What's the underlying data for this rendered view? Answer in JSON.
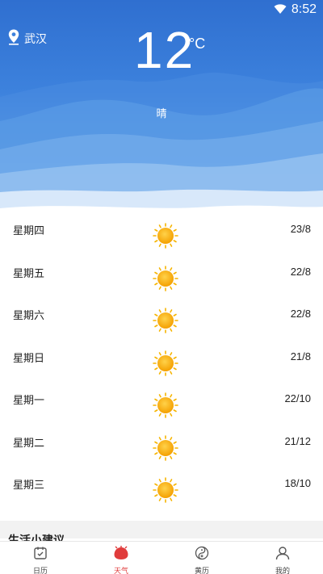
{
  "status": {
    "time": "8:52"
  },
  "location": {
    "city": "武汉"
  },
  "current": {
    "temperature": "12",
    "unit": "°C",
    "condition": "晴"
  },
  "forecast": [
    {
      "day": "星期四",
      "range": "23/8",
      "icon": "sun-icon"
    },
    {
      "day": "星期五",
      "range": "22/8",
      "icon": "sun-icon"
    },
    {
      "day": "星期六",
      "range": "22/8",
      "icon": "sun-icon"
    },
    {
      "day": "星期日",
      "range": "21/8",
      "icon": "sun-icon"
    },
    {
      "day": "星期一",
      "range": "22/10",
      "icon": "sun-icon"
    },
    {
      "day": "星期二",
      "range": "21/12",
      "icon": "sun-icon"
    },
    {
      "day": "星期三",
      "range": "18/10",
      "icon": "sun-icon"
    }
  ],
  "tips": {
    "title": "生活小建议"
  },
  "tabs": [
    {
      "label": "日历",
      "icon": "calendar-icon"
    },
    {
      "label": "天气",
      "icon": "weather-icon",
      "active": true
    },
    {
      "label": "黄历",
      "icon": "yin-yang-icon"
    },
    {
      "label": "我的",
      "icon": "user-icon"
    }
  ],
  "colors": {
    "accent": "#e03c3c",
    "sky": "#3d82dd"
  }
}
